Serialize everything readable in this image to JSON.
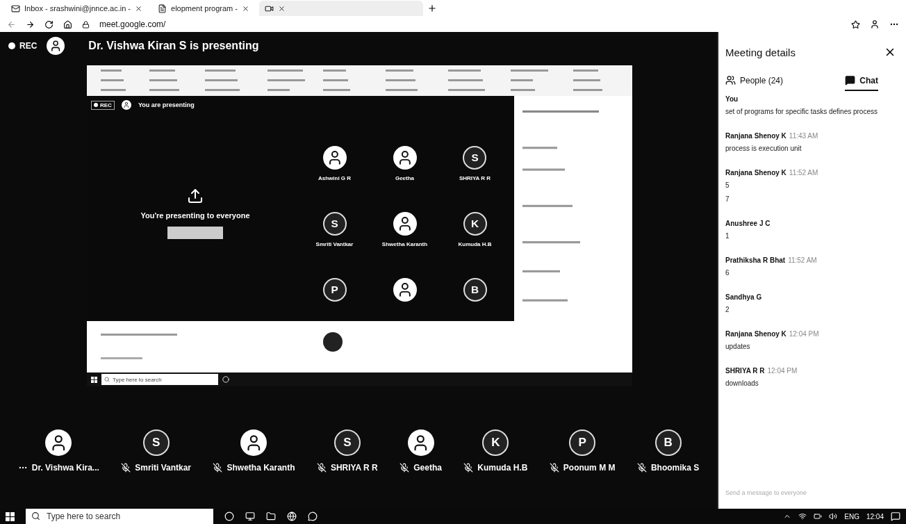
{
  "browser": {
    "tabs": [
      {
        "title": "Inbox - srashwini@jnnce.ac.in -",
        "selected": false
      },
      {
        "title": "elopment program -",
        "selected": false
      },
      {
        "selected": true
      }
    ],
    "url": "meet.google.com/"
  },
  "meeting": {
    "rec": "REC",
    "banner": "Dr. Vishwa Kiran S is presenting",
    "shared_screen": {
      "rec": "REC",
      "banner": "You are presenting",
      "message": "You're presenting to everyone",
      "search_placeholder": "Type here to search",
      "tiles": [
        {
          "kind": "photo",
          "name": "Ashwini G R"
        },
        {
          "kind": "photo",
          "name": "Geetha"
        },
        {
          "kind": "letter",
          "letter": "S",
          "name": "SHRIYA R R"
        },
        {
          "kind": "letter",
          "letter": "S",
          "name": "Smriti Vantkar"
        },
        {
          "kind": "photo",
          "name": "Shwetha Karanth"
        },
        {
          "kind": "letter",
          "letter": "K",
          "name": "Kumuda H.B"
        },
        {
          "kind": "letter",
          "letter": "P"
        },
        {
          "kind": "photo"
        },
        {
          "kind": "letter",
          "letter": "B"
        }
      ]
    },
    "participants": [
      {
        "kind": "photo",
        "name": "Dr. Vishwa Kira...",
        "muted": false
      },
      {
        "kind": "letter",
        "letter": "S",
        "name": "Smriti Vantkar",
        "muted": true
      },
      {
        "kind": "photo",
        "name": "Shwetha Karanth",
        "muted": true
      },
      {
        "kind": "letter",
        "letter": "S",
        "name": "SHRIYA R R",
        "muted": true
      },
      {
        "kind": "photo",
        "name": "Geetha",
        "muted": true
      },
      {
        "kind": "letter",
        "letter": "K",
        "name": "Kumuda H.B",
        "muted": true
      },
      {
        "kind": "letter",
        "letter": "P",
        "name": "Poonum M M",
        "muted": true
      },
      {
        "kind": "letter",
        "letter": "B",
        "name": "Bhoomika S",
        "muted": true
      }
    ]
  },
  "panel": {
    "title": "Meeting details",
    "tabs": [
      {
        "label": "People (24)",
        "selected": false
      },
      {
        "label": "Chat",
        "selected": true
      }
    ],
    "messages": [
      {
        "sender": "You",
        "lines": [
          "set of programs for specific tasks defines process"
        ]
      },
      {
        "sender": "Ranjana Shenoy K",
        "time": "11:43 AM",
        "lines": [
          "process is execution unit"
        ]
      },
      {
        "sender": "Ranjana Shenoy K",
        "time": "11:52 AM",
        "lines": [
          "5",
          "7"
        ]
      },
      {
        "sender": "Anushree J C",
        "lines": [
          "1"
        ]
      },
      {
        "sender": "Prathiksha R Bhat",
        "time": "11:52 AM",
        "lines": [
          "6"
        ]
      },
      {
        "sender": "Sandhya G",
        "lines": [
          "2"
        ]
      },
      {
        "sender": "Ranjana Shenoy K",
        "time": "12:04 PM",
        "lines": [
          "updates"
        ]
      },
      {
        "sender": "SHRIYA R R",
        "time": "12:04 PM",
        "lines": [
          "downloads"
        ]
      }
    ],
    "input": {
      "placeholder": "Send a message to everyone"
    }
  },
  "taskbar": {
    "search_placeholder": "Type here to search",
    "language": "ENG",
    "time": "12:04"
  }
}
